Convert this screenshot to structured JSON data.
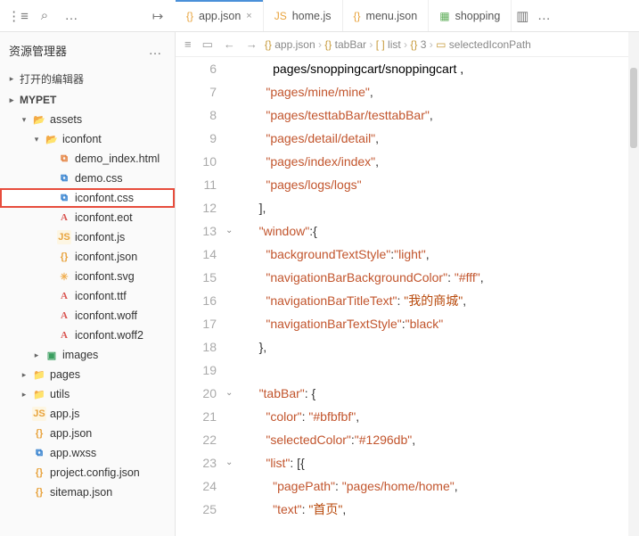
{
  "toolbar": {
    "collapse": "⋮≡",
    "search": "⌕",
    "more": "…",
    "panel": "↦"
  },
  "tabs": [
    {
      "icon": "{}",
      "label": "app.json",
      "close": "×",
      "active": true,
      "iconColor": "#e8a33d"
    },
    {
      "icon": "JS",
      "label": "home.js",
      "iconColor": "#e8a33d"
    },
    {
      "icon": "{}",
      "label": "menu.json",
      "iconColor": "#e8a33d"
    },
    {
      "icon": "▦",
      "label": "shopping",
      "iconColor": "#5fae5a"
    }
  ],
  "tabbar_right": {
    "split": "▥",
    "more": "…"
  },
  "explorer": {
    "title": "资源管理器",
    "more": "…",
    "open_editors": "打开的编辑器",
    "project": "MYPET"
  },
  "tree": [
    {
      "d": 1,
      "chev": "▾",
      "ico": "📂",
      "cls": "fi-folder-open",
      "name": "assets"
    },
    {
      "d": 2,
      "chev": "▾",
      "ico": "📂",
      "cls": "fi-folder-open",
      "name": "iconfont"
    },
    {
      "d": 3,
      "ico": "⧉",
      "cls": "fi-html",
      "name": "demo_index.html"
    },
    {
      "d": 3,
      "ico": "⧉",
      "cls": "fi-css",
      "name": "demo.css"
    },
    {
      "d": 3,
      "ico": "⧉",
      "cls": "fi-css",
      "name": "iconfont.css",
      "hi": true
    },
    {
      "d": 3,
      "ico": "A",
      "cls": "fi-font",
      "name": "iconfont.eot"
    },
    {
      "d": 3,
      "ico": "JS",
      "cls": "fi-js",
      "name": "iconfont.js"
    },
    {
      "d": 3,
      "ico": "{}",
      "cls": "fi-json",
      "name": "iconfont.json"
    },
    {
      "d": 3,
      "ico": "✳",
      "cls": "fi-svg",
      "name": "iconfont.svg"
    },
    {
      "d": 3,
      "ico": "A",
      "cls": "fi-font",
      "name": "iconfont.ttf"
    },
    {
      "d": 3,
      "ico": "A",
      "cls": "fi-font",
      "name": "iconfont.woff"
    },
    {
      "d": 3,
      "ico": "A",
      "cls": "fi-font",
      "name": "iconfont.woff2"
    },
    {
      "d": 2,
      "chev": "▸",
      "ico": "▣",
      "cls": "fi-img",
      "name": "images"
    },
    {
      "d": 1,
      "chev": "▸",
      "ico": "📁",
      "cls": "fi-folder",
      "name": "pages"
    },
    {
      "d": 1,
      "chev": "▸",
      "ico": "📁",
      "cls": "fi-folder",
      "name": "utils"
    },
    {
      "d": 1,
      "ico": "JS",
      "cls": "fi-js",
      "name": "app.js"
    },
    {
      "d": 1,
      "ico": "{}",
      "cls": "fi-json",
      "name": "app.json"
    },
    {
      "d": 1,
      "ico": "⧉",
      "cls": "fi-css",
      "name": "app.wxss"
    },
    {
      "d": 1,
      "ico": "{}",
      "cls": "fi-json",
      "name": "project.config.json"
    },
    {
      "d": 1,
      "ico": "{}",
      "cls": "fi-json",
      "name": "sitemap.json"
    }
  ],
  "crumb_icons": {
    "three": "≡",
    "book": "▭",
    "back": "←",
    "fwd": "→"
  },
  "crumbs": [
    {
      "ico": "{}",
      "t": "app.json"
    },
    {
      "ico": "{}",
      "t": "tabBar"
    },
    {
      "ico": "[ ]",
      "t": "list"
    },
    {
      "ico": "{}",
      "t": "3"
    },
    {
      "ico": "▭",
      "t": "selectedIconPath"
    }
  ],
  "code": {
    "start": 6,
    "fold": {
      "13": "⌄",
      "20": "⌄",
      "23": "⌄"
    },
    "lines": [
      "      pages/snoppingcart/snoppingcart ,",
      "    <s>\"pages/mine/mine\"</s><p>,</p>",
      "    <s>\"pages/testtabBar/testtabBar\"</s><p>,</p>",
      "    <s>\"pages/detail/detail\"</s><p>,</p>",
      "    <s>\"pages/index/index\"</s><p>,</p>",
      "    <s>\"pages/logs/logs\"</s>",
      "  <p>],</p>",
      "  <k>\"window\"</k><p>:{</p>",
      "    <k>\"backgroundTextStyle\"</k><p>:</p><s>\"light\"</s><p>,</p>",
      "    <k>\"navigationBarBackgroundColor\"</k><p>: </p><s>\"#fff\"</s><p>,</p>",
      "    <k>\"navigationBarTitleText\"</k><p>: </p><cn>\"我的商城\"</cn><p>,</p>",
      "    <k>\"navigationBarTextStyle\"</k><p>:</p><s>\"black\"</s>",
      "  <p>},</p>",
      "",
      "  <k>\"tabBar\"</k><p>: {</p>",
      "    <k>\"color\"</k><p>: </p><s>\"#bfbfbf\"</s><p>,</p>",
      "    <k>\"selectedColor\"</k><p>:</p><s>\"#1296db\"</s><p>,</p>",
      "    <k>\"list\"</k><p>: [{</p>",
      "      <pp>\"pagePath\"</pp><p>: </p><s>\"pages/home/home\"</s><p>,</p>",
      "      <pp>\"text\"</pp><p>: </p><cn>\"首页\"</cn><p>,</p>"
    ]
  }
}
